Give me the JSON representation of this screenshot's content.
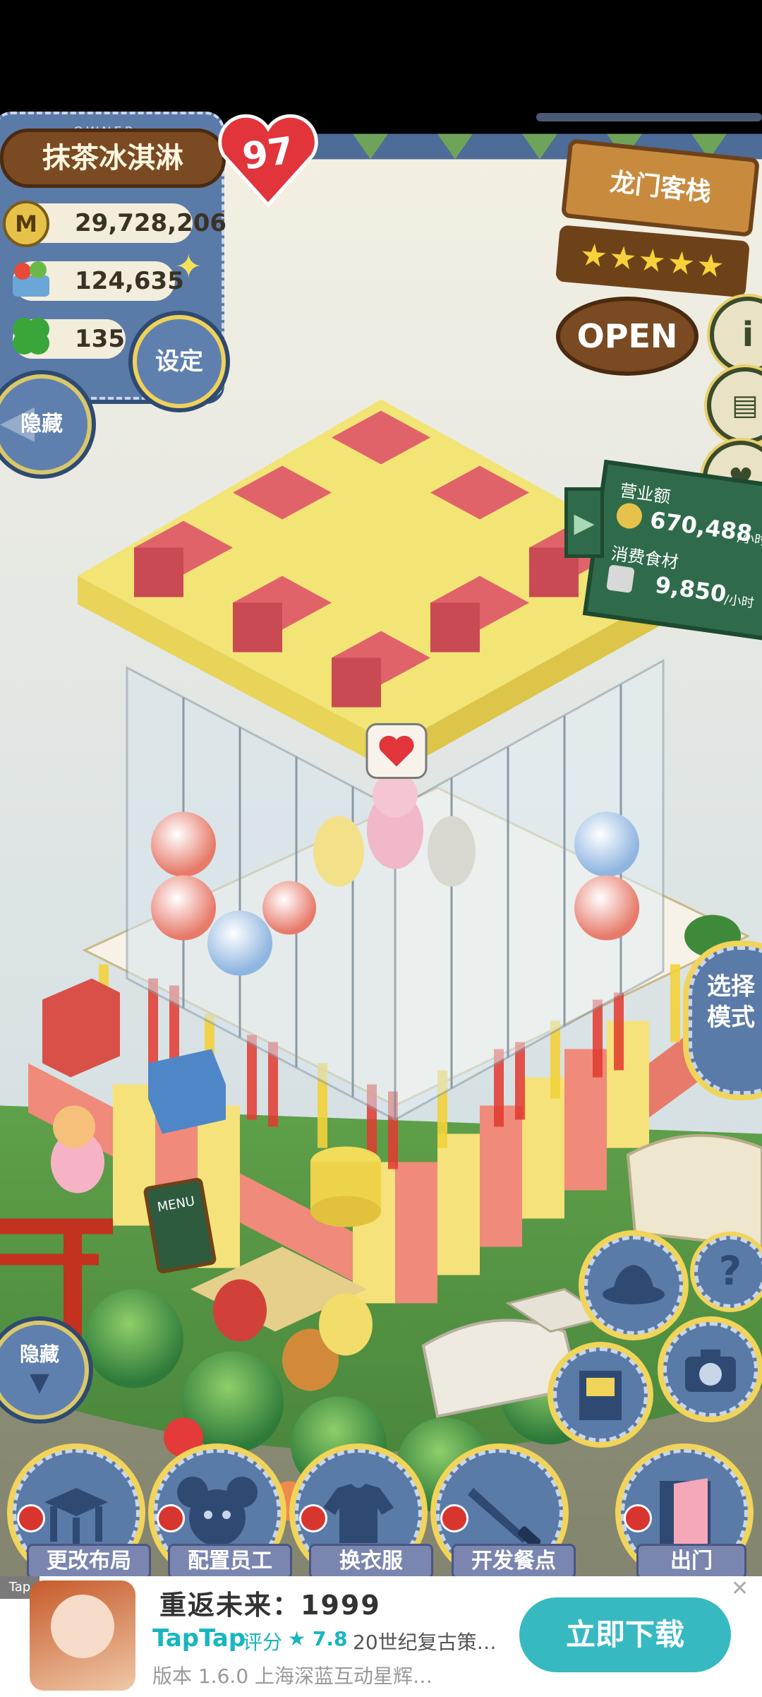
{
  "owner": {
    "tag": "OWNER",
    "name": "抹茶冰淇淋",
    "level": "97",
    "coins_icon": "M",
    "coins": "29,728,206",
    "food": "124,635",
    "clover": "135"
  },
  "buttons": {
    "settings": "设定",
    "hide_top": "隐藏",
    "hide_bottom": "隐藏",
    "select_mode": "选择模式"
  },
  "shop": {
    "name": "龙门客栈",
    "stars": 5,
    "status": "OPEN"
  },
  "stats_board": {
    "revenue_label": "营业额",
    "revenue_value": "670,488",
    "revenue_unit": "/小时",
    "food_label": "消费食材",
    "food_value": "9,850",
    "food_unit": "/小时"
  },
  "menu_sign": "MENU",
  "toolbar": {
    "edit_layout": "更改布局",
    "staff": "配置员工",
    "outfit": "换衣服",
    "develop_menu": "开发餐点",
    "exit": "出门",
    "help": "?"
  },
  "ad": {
    "corner_tag": "Tap",
    "title": "重返未来：1999",
    "brand": "TapTap",
    "rating_label": "评分",
    "rating": "★ 7.8",
    "tagline": "20世纪复古策…",
    "meta": "版本 1.6.0   上海深蓝互动星辉…",
    "cta": "立即下载",
    "close": "✕"
  },
  "colors": {
    "denim": "#5a7aa8",
    "wood": "#c88b3e",
    "board": "#2f6b4a",
    "accent_yellow": "#f1d45a",
    "ad_button": "#37b9c1",
    "taptap": "#17b6c0"
  }
}
